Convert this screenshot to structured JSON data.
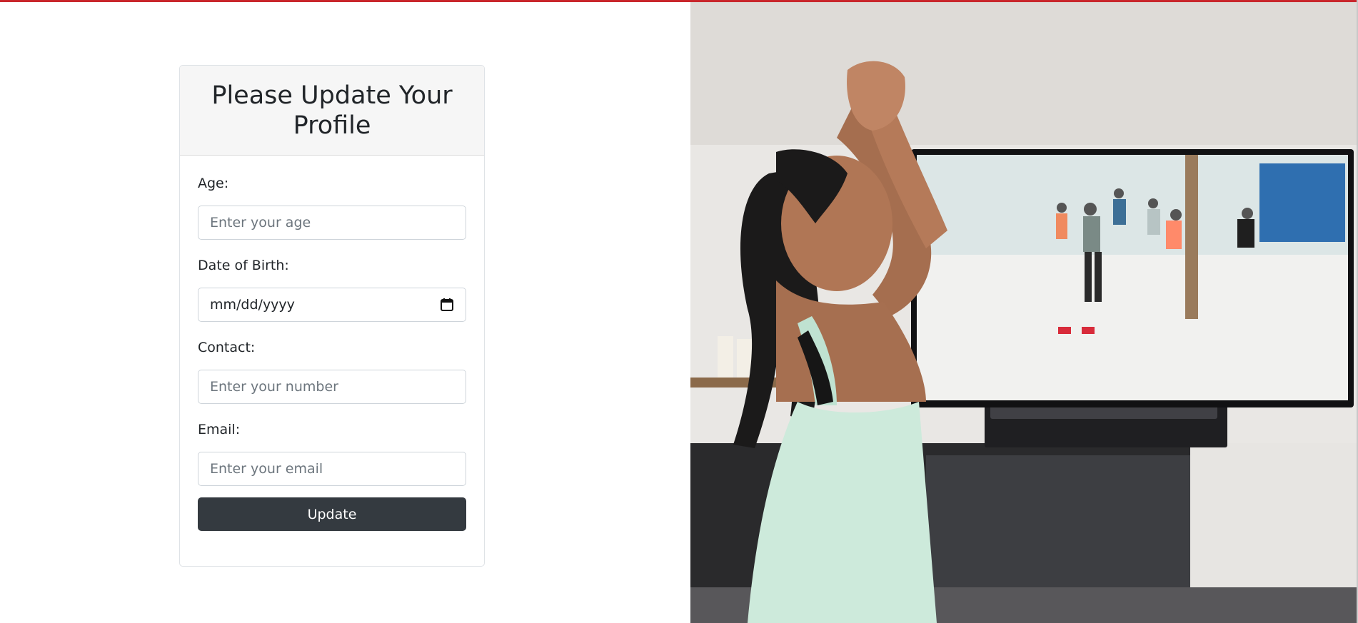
{
  "form": {
    "title": "Please Update Your Profile",
    "fields": {
      "age": {
        "label": "Age:",
        "placeholder": "Enter your age"
      },
      "dob": {
        "label": "Date of Birth:",
        "placeholder": "mm/dd/yyyy"
      },
      "contact": {
        "label": "Contact:",
        "placeholder": "Enter your number"
      },
      "email": {
        "label": "Email:",
        "placeholder": "Enter your email"
      }
    },
    "submit_label": "Update"
  },
  "colors": {
    "accent_bar": "#c9262b",
    "button": "#343a40",
    "header_bg": "#f6f6f6"
  },
  "icons": {
    "date_picker": "calendar-icon"
  }
}
